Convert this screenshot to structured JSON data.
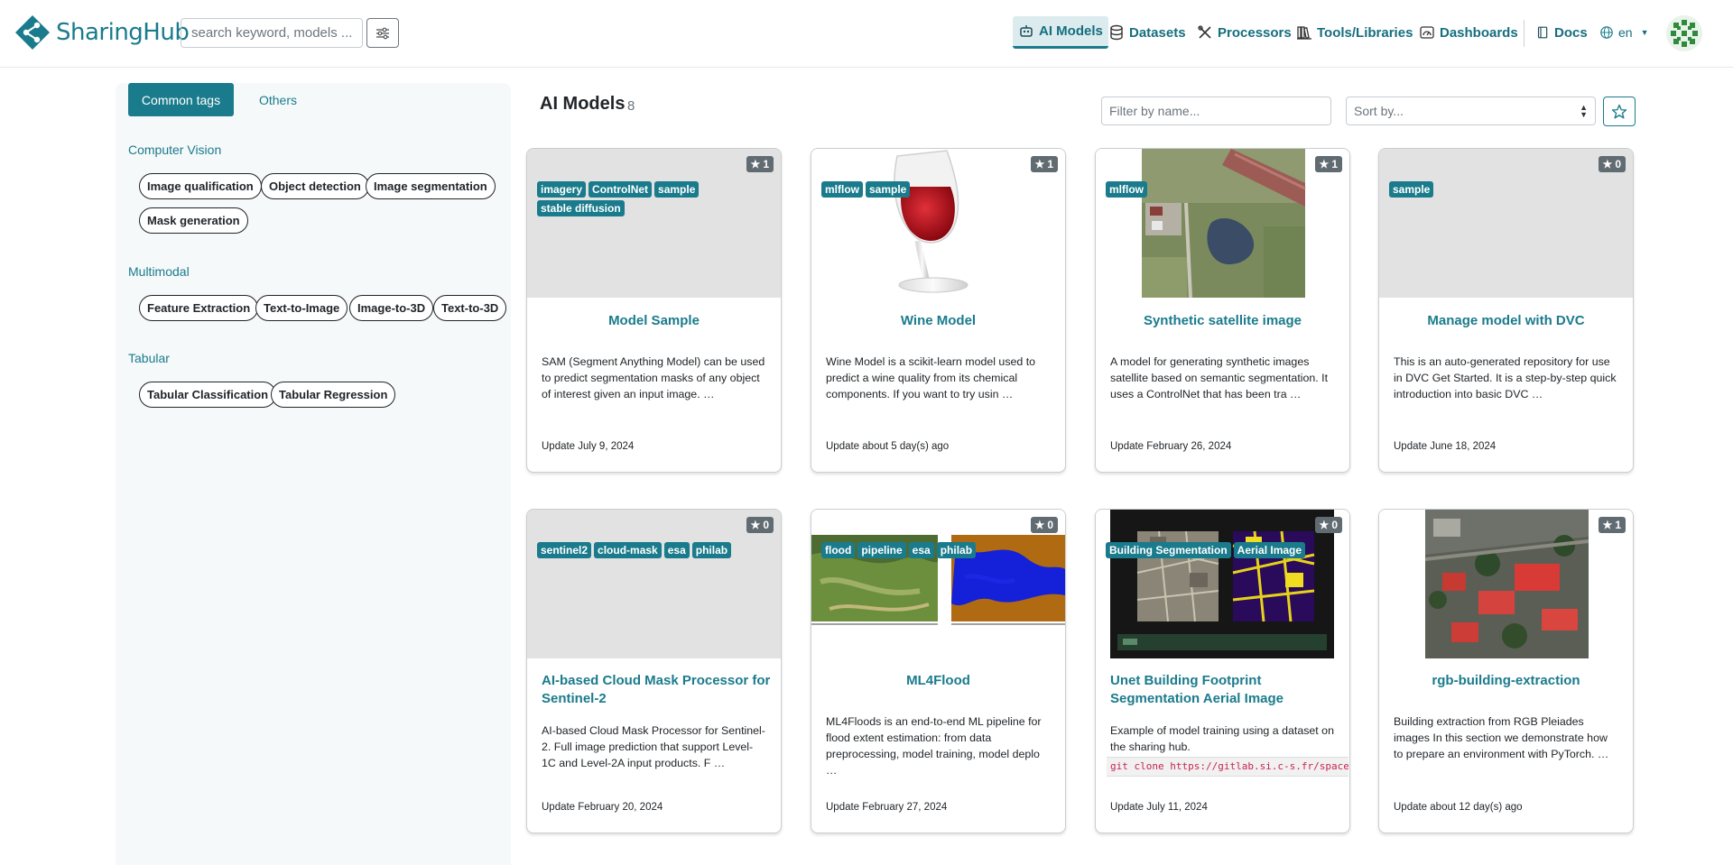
{
  "brand": {
    "name": "SharingHub"
  },
  "search": {
    "placeholder": "search keyword, models ..."
  },
  "nav": [
    {
      "label": "AI Models",
      "icon": "robot-icon",
      "active": true
    },
    {
      "label": "Datasets",
      "icon": "database-icon"
    },
    {
      "label": "Processors",
      "icon": "tools-icon"
    },
    {
      "label": "Tools/Libraries",
      "icon": "library-icon"
    },
    {
      "label": "Dashboards",
      "icon": "dashboard-icon"
    },
    {
      "label": "Docs",
      "icon": "book-icon"
    },
    {
      "label": "en",
      "icon": "globe-icon"
    }
  ],
  "sidebar": {
    "tabs": [
      "Common tags",
      "Others"
    ],
    "categories": [
      {
        "title": "Computer Vision",
        "tags": [
          "Image qualification",
          "Object detection",
          "Image segmentation",
          "Mask generation"
        ]
      },
      {
        "title": "Multimodal",
        "tags": [
          "Feature Extraction",
          "Text-to-Image",
          "Image-to-3D",
          "Text-to-3D"
        ]
      },
      {
        "title": "Tabular",
        "tags": [
          "Tabular Classification",
          "Tabular Regression"
        ]
      }
    ]
  },
  "main": {
    "title": "AI Models",
    "count": "8",
    "filter_placeholder": "Filter by name...",
    "sort_label": "Sort by..."
  },
  "cards": [
    {
      "title": "Model Sample",
      "stars": "1",
      "tags": [
        "imagery",
        "ControlNet",
        "sample",
        "stable diffusion"
      ],
      "desc": "SAM (Segment Anything Model) can be used to predict segmentation masks of any object of interest given an input image. …",
      "update": "Update July 9, 2024"
    },
    {
      "title": "Wine Model",
      "stars": "1",
      "tags": [
        "mlflow",
        "sample"
      ],
      "desc": "Wine Model is a scikit-learn model used to predict a wine quality from its chemical components. If you want to try usin …",
      "update": "Update about 5 day(s) ago"
    },
    {
      "title": "Synthetic satellite image",
      "stars": "1",
      "tags": [
        "mlflow"
      ],
      "desc": "A model for generating synthetic images satellite based on semantic segmentation. It uses a ControlNet that has been tra …",
      "update": "Update February 26, 2024"
    },
    {
      "title": "Manage model with DVC",
      "stars": "0",
      "tags": [
        "sample"
      ],
      "desc": "This is an auto-generated repository for use in DVC Get Started. It is a step-by-step quick introduction into basic DVC …",
      "update": "Update June 18, 2024"
    },
    {
      "title": "AI-based Cloud Mask Processor for Sentinel-2",
      "stars": "0",
      "tags": [
        "sentinel2",
        "cloud-mask",
        "esa",
        "philab"
      ],
      "desc": "AI-based Cloud Mask Processor for Sentinel-2. Full image prediction that support Level-1C and Level-2A input products. F …",
      "update": "Update February 20, 2024"
    },
    {
      "title": "ML4Flood",
      "stars": "0",
      "tags": [
        "flood",
        "pipeline",
        "esa",
        "philab"
      ],
      "desc": "ML4Floods is an end-to-end ML pipeline for flood extent estimation: from data preprocessing, model training, model deplo …",
      "update": "Update February 27, 2024"
    },
    {
      "title": "Unet Building Footprint Segmentation Aerial Image",
      "stars": "0",
      "tags": [
        "Building Segmentation",
        "Aerial Image"
      ],
      "desc": "Example of model training using a dataset on the sharing hub.",
      "code": "git clone https://gitlab.si.c-s.fr/space_",
      "update": "Update July 11, 2024"
    },
    {
      "title": "rgb-building-extraction",
      "stars": "1",
      "tags": [],
      "desc": "Building extraction from RGB Pleiades images In this section we demonstrate how to prepare an environment with PyTorch. …",
      "update": "Update about 12 day(s) ago"
    }
  ],
  "colors": {
    "accent": "#1a7b8c",
    "badge": "#616b72"
  }
}
